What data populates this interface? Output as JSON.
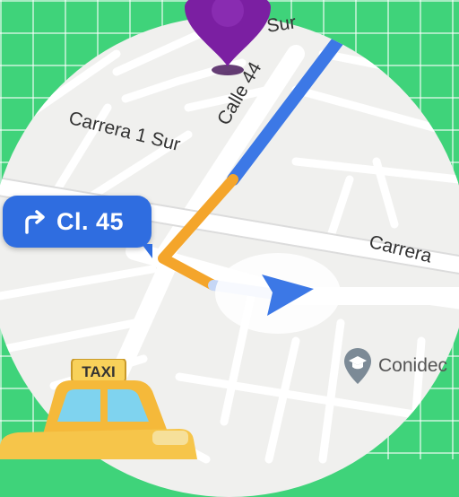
{
  "navigation": {
    "next_turn": {
      "icon": "turn-right-arrow-icon",
      "street": "Cl. 45"
    }
  },
  "map": {
    "street_labels": [
      "Carrera 1 Sur",
      "Calle 44",
      "Sur",
      "Carrera"
    ],
    "poi": {
      "name": "Conidec",
      "icon": "graduation-cap-pin-icon"
    }
  },
  "colors": {
    "background": "#3fd37a",
    "route_clear": "#4285f4",
    "route_traffic": "#f4a52b",
    "destination_pin": "#7b1fa2",
    "turn_banner": "#2f6de0"
  },
  "overlay": {
    "taxi_sign": "TAXI"
  }
}
